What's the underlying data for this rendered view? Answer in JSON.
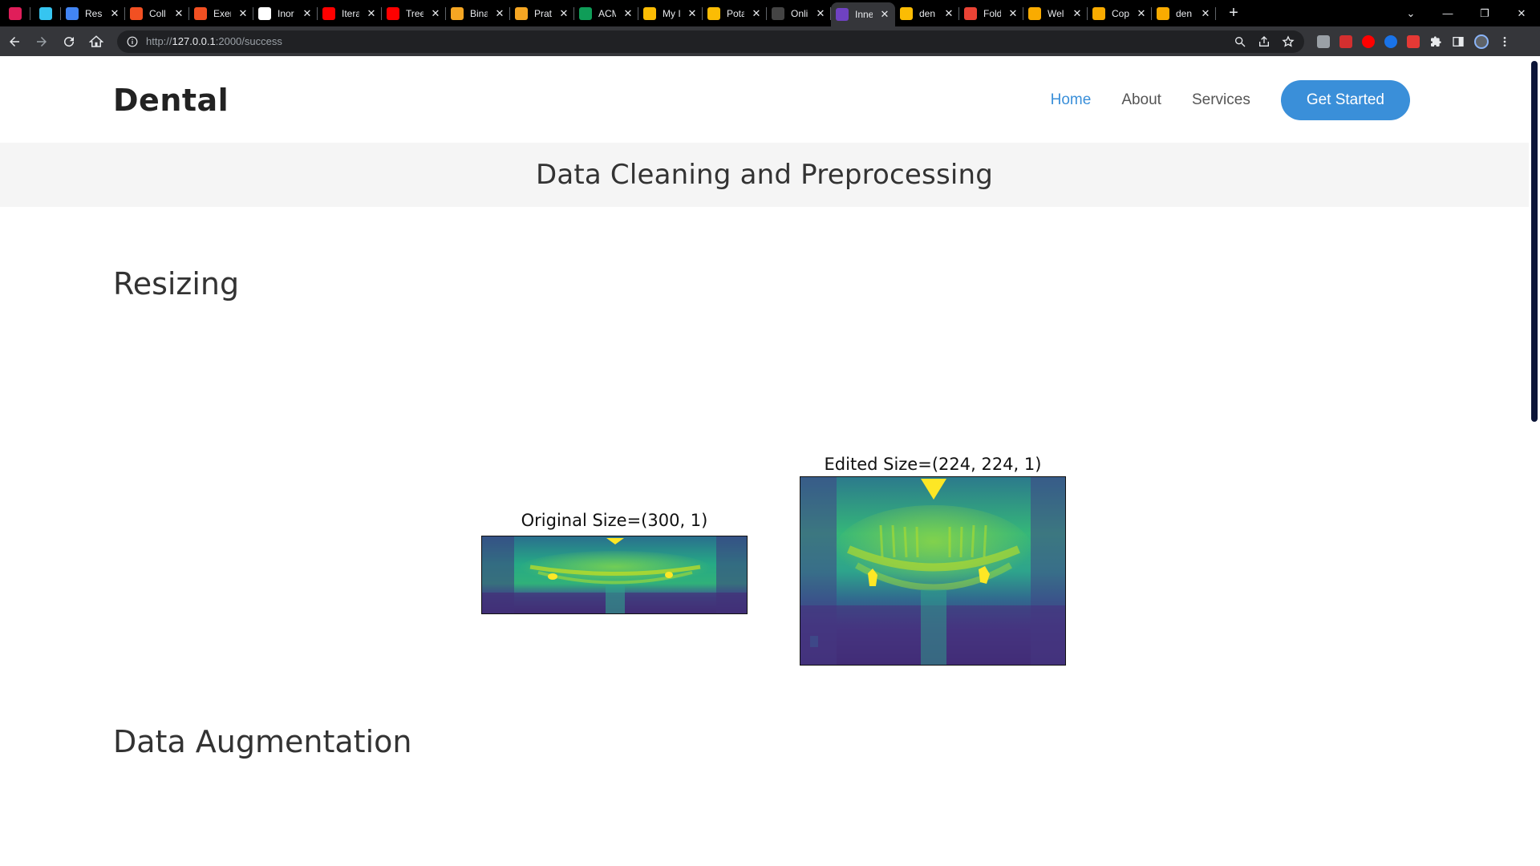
{
  "browser": {
    "tabs": [
      {
        "icon": "slack-icon",
        "title": "",
        "pinned": true,
        "color": "#e01e5a"
      },
      {
        "icon": "slack-icon",
        "title": "",
        "pinned": true,
        "color": "#36c5f0"
      },
      {
        "icon": "docs-icon",
        "title": "Resu",
        "color": "#4285f4"
      },
      {
        "icon": "microsoft-icon",
        "title": "Coll",
        "color": "#f25022"
      },
      {
        "icon": "microsoft-icon",
        "title": "Exer",
        "color": "#f25022"
      },
      {
        "icon": "google-icon",
        "title": "Inor",
        "color": "#ffffff"
      },
      {
        "icon": "youtube-icon",
        "title": "Itera",
        "color": "#ff0000"
      },
      {
        "icon": "youtube-icon",
        "title": "Tree",
        "color": "#ff0000"
      },
      {
        "icon": "codeforces-icon",
        "title": "Bina",
        "color": "#f5a623"
      },
      {
        "icon": "codeforces-icon",
        "title": "Prat",
        "color": "#f5a623"
      },
      {
        "icon": "sheets-icon",
        "title": "ACM",
        "color": "#0f9d58"
      },
      {
        "icon": "drive-icon",
        "title": "My I",
        "color": "#fbbc04"
      },
      {
        "icon": "drive-icon",
        "title": "Pota",
        "color": "#fbbc04"
      },
      {
        "icon": "d-icon",
        "title": "Onli",
        "color": "#444444"
      },
      {
        "icon": "b-icon",
        "title": "Inne",
        "active": true,
        "color": "#6f42c1"
      },
      {
        "icon": "drive-icon",
        "title": "den",
        "color": "#fbbc04"
      },
      {
        "icon": "gmail-icon",
        "title": "Fold",
        "color": "#ea4335"
      },
      {
        "icon": "colab-icon",
        "title": "Wel",
        "color": "#f9ab00"
      },
      {
        "icon": "colab-icon",
        "title": "Cop",
        "color": "#f9ab00"
      },
      {
        "icon": "colab-icon",
        "title": "den",
        "color": "#f9ab00"
      }
    ],
    "url_prefix": "http://",
    "url_host": "127.0.0.1",
    "url_rest": ":2000/success"
  },
  "site": {
    "logo": "Dental",
    "nav": {
      "home": "Home",
      "about": "About",
      "services": "Services",
      "cta": "Get Started"
    },
    "banner_title": "Data Cleaning and Preprocessing",
    "sections": {
      "resizing": "Resizing",
      "augmentation": "Data Augmentation"
    },
    "figures": {
      "original_caption": "Original Size=(300, 1)",
      "edited_caption": "Edited Size=(224, 224, 1)"
    },
    "colors": {
      "accent": "#3a8fd9",
      "scrollbar_thumb": "#0b1437"
    }
  }
}
